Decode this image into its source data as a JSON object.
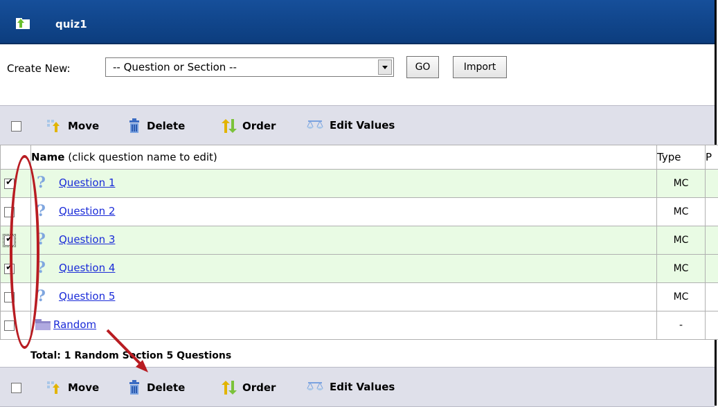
{
  "window": {
    "title": "quiz1"
  },
  "create": {
    "label": "Create New:",
    "select_value": "-- Question or Section --",
    "go_label": "GO",
    "import_label": "Import"
  },
  "toolbar": {
    "move_label": "Move",
    "delete_label": "Delete",
    "order_label": "Order",
    "edit_values_label": "Edit Values"
  },
  "table": {
    "header_name_bold": "Name",
    "header_name_hint": " (click question name to edit)",
    "header_type": "Type",
    "header_next": "P",
    "rows": [
      {
        "name": "Question 1",
        "type": "MC",
        "checked": true
      },
      {
        "name": "Question 2",
        "type": "MC",
        "checked": false
      },
      {
        "name": "Question 3",
        "type": "MC",
        "checked": true
      },
      {
        "name": "Question 4",
        "type": "MC",
        "checked": true
      },
      {
        "name": "Question 5",
        "type": "MC",
        "checked": false
      },
      {
        "name": "Random",
        "type": "-",
        "checked": false
      }
    ]
  },
  "total": {
    "text": "Total: 1 Random Section  5 Questions"
  },
  "colors": {
    "title_bar": "#0c3d7e",
    "toolbar": "#dfe0ea",
    "selected_row": "#e9fbe4",
    "annotation": "#b81c22",
    "link": "#1a2bd8"
  }
}
